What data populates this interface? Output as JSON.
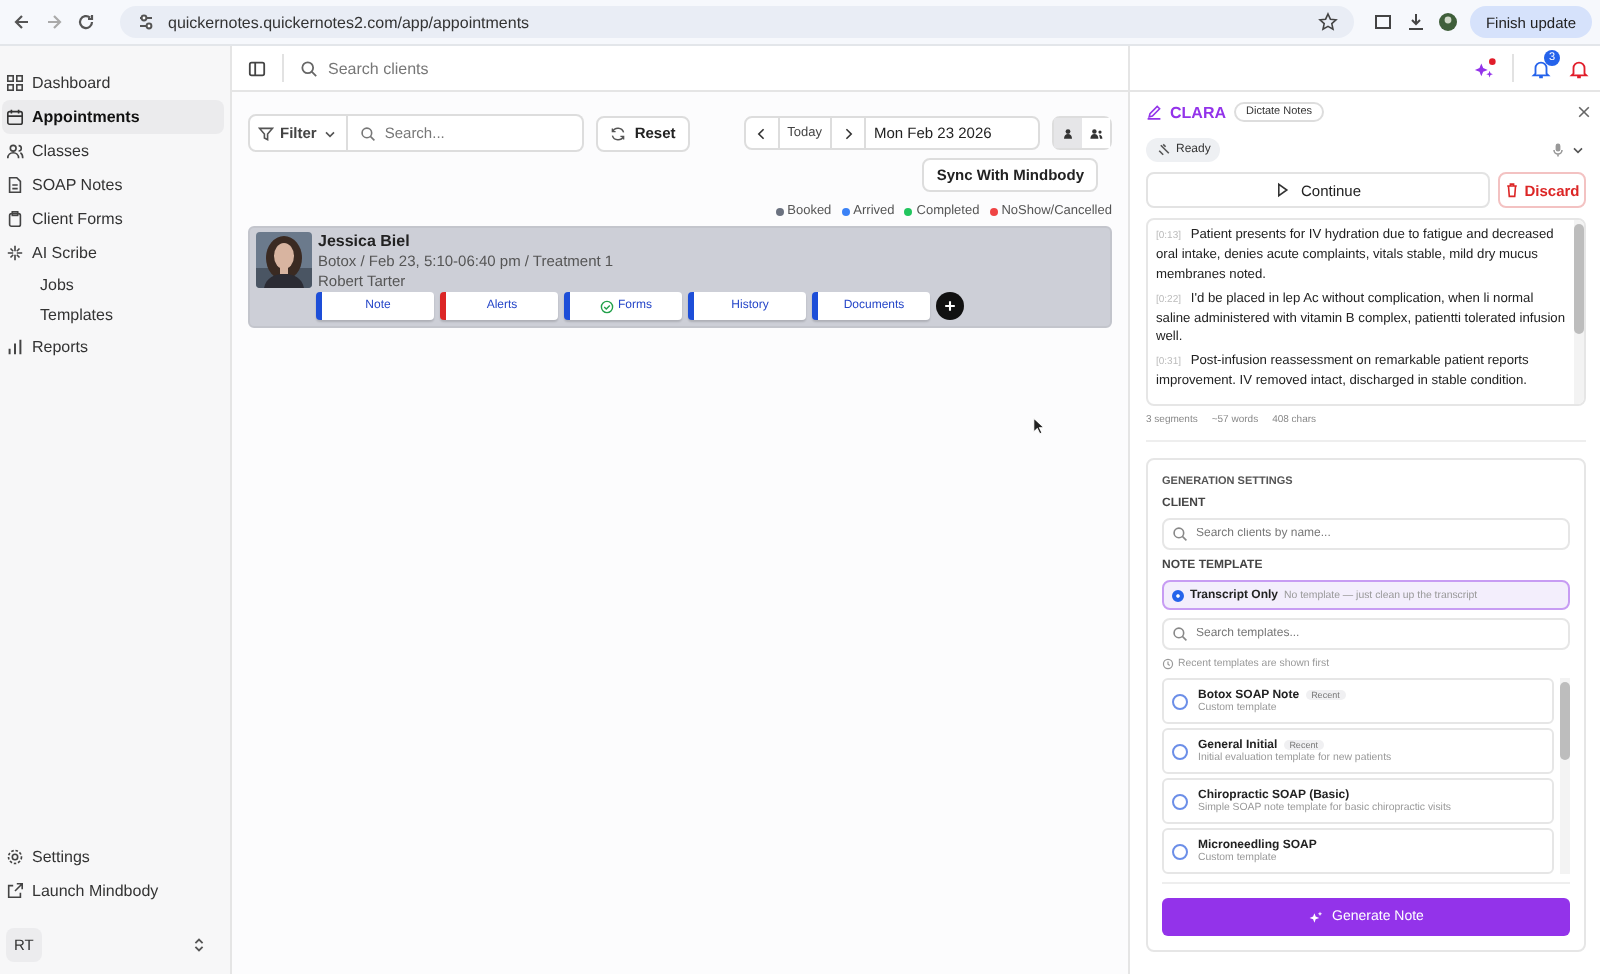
{
  "browser": {
    "url": "quickernotes.quickernotes2.com/app/appointments",
    "update_button": "Finish update"
  },
  "sidebar": {
    "items": [
      {
        "label": "Dashboard",
        "selected": false
      },
      {
        "label": "Appointments",
        "selected": true
      },
      {
        "label": "Classes",
        "selected": false
      },
      {
        "label": "SOAP Notes",
        "selected": false
      },
      {
        "label": "Client Forms",
        "selected": false
      },
      {
        "label": "AI Scribe",
        "selected": false,
        "children": [
          {
            "label": "Jobs",
            "selected": false
          },
          {
            "label": "Templates",
            "selected": false
          }
        ]
      },
      {
        "label": "Reports",
        "selected": false
      }
    ],
    "bottom_items": [
      {
        "label": "Settings"
      },
      {
        "label": "Launch Mindbody"
      }
    ],
    "user_initials": "RT"
  },
  "header": {
    "search_placeholder": "Search clients",
    "notification_count": "3"
  },
  "toolbar": {
    "filter": "Filter",
    "search_placeholder": "Search...",
    "reset": "Reset",
    "today": "Today",
    "date": "Mon Feb 23 2026",
    "views": [
      {
        "kind": "single",
        "selected": true
      },
      {
        "kind": "group",
        "selected": false
      }
    ],
    "sync": "Sync With Mindbody"
  },
  "legend": [
    {
      "label": "Booked",
      "color": "#6b7280"
    },
    {
      "label": "Arrived",
      "color": "#3b82f6"
    },
    {
      "label": "Completed",
      "color": "#22c55e"
    },
    {
      "label": "NoShow/Cancelled",
      "color": "#ef4444"
    }
  ],
  "appointment": {
    "name": "Jessica Biel",
    "details": "Botox / Feb 23, 5:10-06:40 pm / Treatment 1",
    "provider": "Robert Tarter",
    "actions": [
      {
        "label": "Note",
        "color": "#1d4ed8",
        "checked": false
      },
      {
        "label": "Alerts",
        "color": "#dc2626",
        "checked": false
      },
      {
        "label": "Forms",
        "color": "#1d4ed8",
        "checked": true
      },
      {
        "label": "History",
        "color": "#1d4ed8",
        "checked": false
      },
      {
        "label": "Documents",
        "color": "#1d4ed8",
        "checked": false
      }
    ]
  },
  "panel": {
    "title": "CLARA",
    "tag": "Dictate Notes",
    "status": "Ready",
    "continue": "Continue",
    "discard": "Discard",
    "transcript": [
      {
        "time": "[0:13]",
        "text": "Patient presents for IV hydration due to fatigue and decreased oral intake, denies acute complaints, vitals stable, mild dry mucus membranes noted."
      },
      {
        "time": "[0:22]",
        "text": "I'd be placed in lep Ac without complication, when li normal saline administered with vitamin B complex, patientti tolerated infusion well."
      },
      {
        "time": "[0:31]",
        "text": "Post-infusion reassessment on remarkable patient reports improvement. IV removed intact, discharged in stable condition."
      }
    ],
    "stats": [
      "3 segments",
      "~57 words",
      "408 chars"
    ],
    "settings": {
      "heading": "GENERATION SETTINGS",
      "client_label": "CLIENT",
      "client_placeholder": "Search clients by name...",
      "template_label": "NOTE TEMPLATE",
      "transcript_only": {
        "name": "Transcript Only",
        "desc": "No template — just clean up the transcript",
        "selected": true
      },
      "template_search_placeholder": "Search templates...",
      "hint": "Recent templates are shown first",
      "templates": [
        {
          "name": "Botox SOAP Note",
          "tag": "Recent",
          "desc": "Custom template",
          "selected": false
        },
        {
          "name": "General Initial",
          "tag": "Recent",
          "desc": "Initial evaluation template for new patients",
          "selected": false
        },
        {
          "name": "Chiropractic SOAP (Basic)",
          "desc": "Simple SOAP note template for basic chiropractic visits",
          "selected": false
        },
        {
          "name": "Microneedling SOAP",
          "desc": "Custom template",
          "selected": false
        }
      ],
      "generate": "Generate Note"
    }
  }
}
